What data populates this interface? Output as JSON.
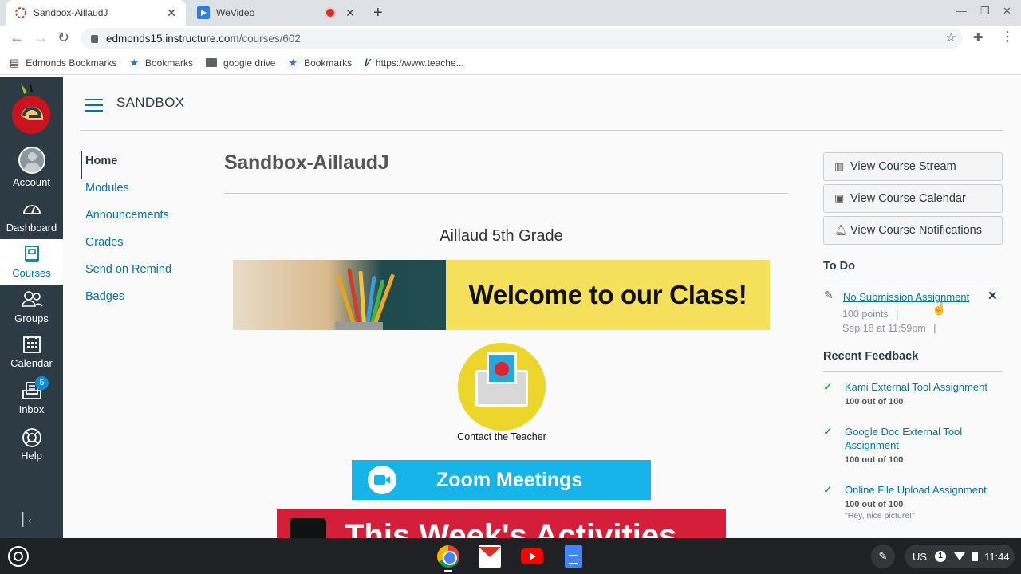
{
  "browser": {
    "tabs": [
      {
        "title": "Sandbox-AillaudJ",
        "favicon": "canvas-icon",
        "active": true
      },
      {
        "title": "WeVideo",
        "favicon": "wevideo-icon",
        "active": false,
        "recording": true
      }
    ],
    "url_host": "edmonds15.instructure.com",
    "url_path": "/courses/602",
    "bookmarks": [
      {
        "label": "Edmonds Bookmarks",
        "icon": "apps-folder-icon"
      },
      {
        "label": "Bookmarks",
        "icon": "star-icon"
      },
      {
        "label": "google drive",
        "icon": "folder-icon"
      },
      {
        "label": "Bookmarks",
        "icon": "star-icon"
      },
      {
        "label": "https://www.teache...",
        "icon": "teacher-site-icon"
      }
    ]
  },
  "global_nav": {
    "items": [
      {
        "label": "Account",
        "icon": "avatar-icon"
      },
      {
        "label": "Dashboard",
        "icon": "dashboard-icon"
      },
      {
        "label": "Courses",
        "icon": "courses-icon",
        "active": true
      },
      {
        "label": "Groups",
        "icon": "groups-icon"
      },
      {
        "label": "Calendar",
        "icon": "calendar-icon"
      },
      {
        "label": "Inbox",
        "icon": "inbox-icon",
        "badge": "5"
      },
      {
        "label": "Help",
        "icon": "help-icon"
      }
    ]
  },
  "header": {
    "breadcrumb": "SANDBOX"
  },
  "course_nav": [
    {
      "label": "Home",
      "active": true
    },
    {
      "label": "Modules"
    },
    {
      "label": "Announcements"
    },
    {
      "label": "Grades"
    },
    {
      "label": "Send on Remind"
    },
    {
      "label": "Badges"
    }
  ],
  "main": {
    "title": "Sandbox-AillaudJ",
    "subtitle": "Aillaud 5th Grade",
    "welcome_banner": "Welcome to our Class!",
    "contact_label": "Contact the Teacher",
    "zoom_label": "Zoom Meetings",
    "activities_label": "This Week's Activities"
  },
  "sidebar": {
    "buttons": [
      {
        "label": "View Course Stream",
        "icon": "stream-icon"
      },
      {
        "label": "View Course Calendar",
        "icon": "calendar-icon"
      },
      {
        "label": "View Course Notifications",
        "icon": "bell-icon"
      }
    ],
    "todo_heading": "To Do",
    "todo": {
      "title": "No Submission Assignment",
      "points": "100 points",
      "due": "Sep 18 at 11:59pm"
    },
    "feedback_heading": "Recent Feedback",
    "feedback": [
      {
        "title": "Kami External Tool Assignment",
        "score": "100 out of 100"
      },
      {
        "title": "Google Doc External Tool Assignment",
        "score": "100 out of 100"
      },
      {
        "title": "Online File Upload Assignment",
        "score": "100 out of 100",
        "comment": "\"Hey, nice picture!\""
      }
    ]
  },
  "shelf": {
    "apps": [
      "Chrome",
      "Gmail",
      "YouTube",
      "Docs"
    ],
    "locale": "US",
    "notifications": "1",
    "time": "11:44"
  },
  "colors": {
    "canvas_nav": "#2d3b45",
    "link": "#0374b5",
    "success": "#0b874b",
    "welcome_bg": "#f5e05c",
    "zoom_bg": "#16b4e8",
    "activities_bg": "#d51e3a"
  }
}
